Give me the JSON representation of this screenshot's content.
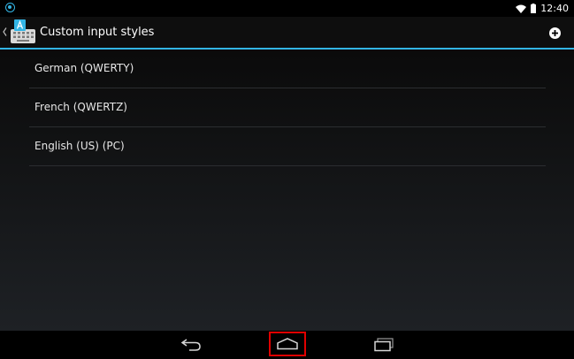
{
  "status_bar": {
    "time": "12:40",
    "wifi_icon": "wifi-icon",
    "battery_icon": "battery-icon",
    "notification_icon": "app-notification-icon"
  },
  "action_bar": {
    "title": "Custom input styles",
    "up_icon": "back-caret-icon",
    "app_icon": "keyboard-icon",
    "action_icon": "add-icon"
  },
  "list": {
    "items": [
      {
        "label": "German (QWERTY)"
      },
      {
        "label": "French (QWERTZ)"
      },
      {
        "label": "English (US) (PC)"
      }
    ]
  },
  "nav_bar": {
    "back_icon": "back-icon",
    "home_icon": "home-icon",
    "recents_icon": "recents-icon"
  },
  "colors": {
    "accent": "#33b5e5",
    "highlight": "#e00000"
  }
}
